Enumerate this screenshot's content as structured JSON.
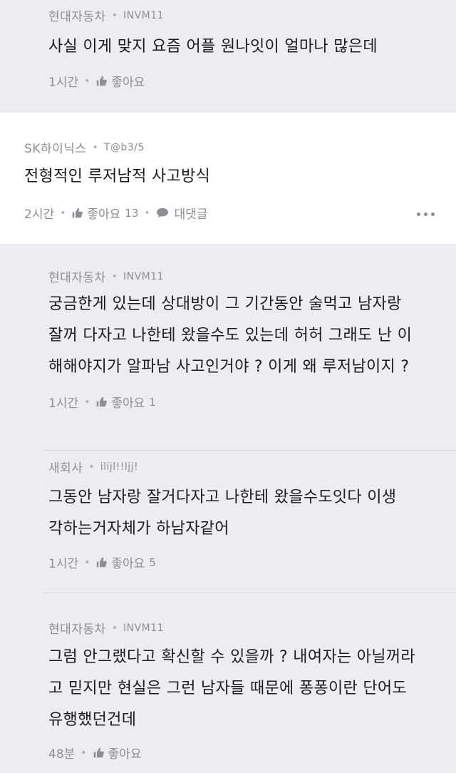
{
  "comments": [
    {
      "company": "현대자동차",
      "nickname": "INVM11",
      "text": "사실 이게 맞지 요즘 어플 원나잇이 얼마나 많은데",
      "time": "1시간",
      "like_label": "좋아요",
      "like_count": ""
    },
    {
      "company": "SK하이닉스",
      "nickname": "T@b3/5",
      "text": "전형적인 루저남적 사고방식",
      "time": "2시간",
      "like_label": "좋아요",
      "like_count": "13",
      "reply_label": "대댓글"
    },
    {
      "company": "현대자동차",
      "nickname": "INVM11",
      "text": "궁금한게 있는데 상대방이 그 기간동안 술먹고 남자랑\n잘꺼 다자고 나한테 왔을수도 있는데 허허 그래도 난 이\n해해야지가 알파남 사고인거야 ? 이게 왜 루저남이지 ?",
      "time": "1시간",
      "like_label": "좋아요",
      "like_count": "1"
    },
    {
      "company": "새회사",
      "nickname": "ilijl!!ljj!",
      "text": "그동안 남자랑 잘거다자고 나한테 왔을수도잇다 이생\n각하는거자체가 하남자같어",
      "time": "1시간",
      "like_label": "좋아요",
      "like_count": "5"
    },
    {
      "company": "현대자동차",
      "nickname": "INVM11",
      "text": "그럼 안그랬다고 확신할 수 있을까 ? 내여자는 아닐꺼라\n고 믿지만 현실은 그런 남자들 때문에 퐁퐁이란 단어도\n유행했던건데",
      "time": "48분",
      "like_label": "좋아요",
      "like_count": ""
    }
  ],
  "icons": {
    "like": "thumbs-up-icon",
    "reply": "speech-bubble-icon",
    "more": "more-dots-icon"
  }
}
